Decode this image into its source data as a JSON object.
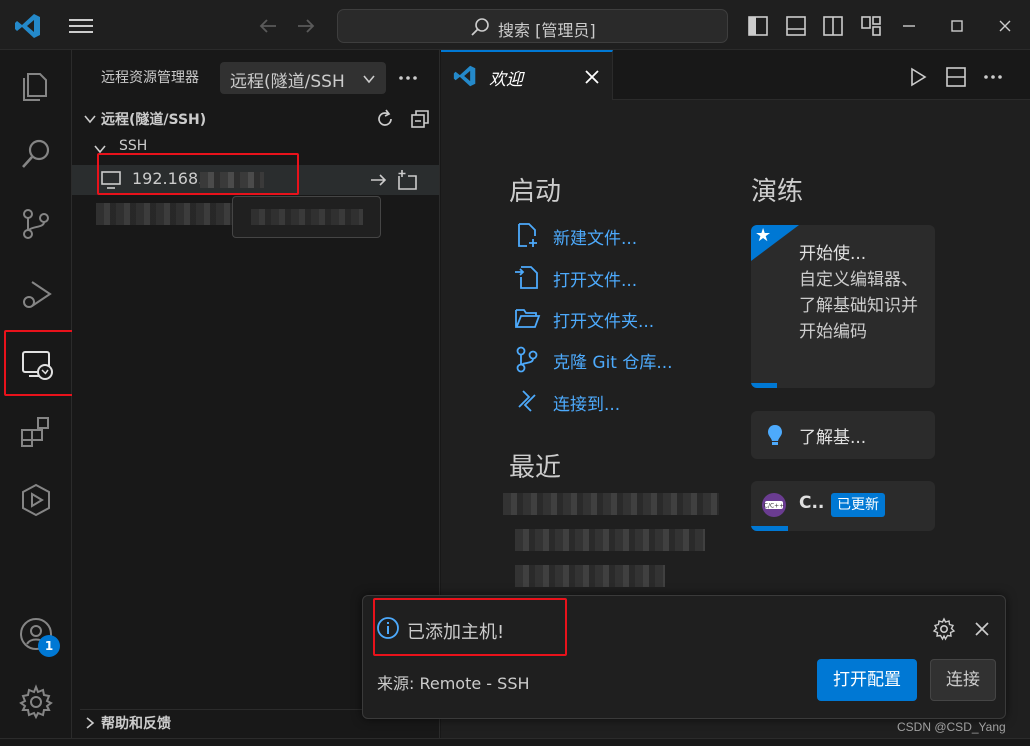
{
  "search": {
    "text": "搜索 [管理员]"
  },
  "sidebar": {
    "title": "远程资源管理器",
    "dropdown": "远程(隧道/SSH",
    "section": "远程(隧道/SSH)",
    "ssh_label": "SSH",
    "host": "192.168.",
    "help": "帮助和反馈"
  },
  "activity": {
    "accounts_badge": "1"
  },
  "editor": {
    "tab_label": "欢迎",
    "start_heading": "启动",
    "start_items": [
      "新建文件...",
      "打开文件...",
      "打开文件夹...",
      "克隆 Git 仓库...",
      "连接到..."
    ],
    "recent_heading": "最近",
    "walkthrough_heading": "演练",
    "walkthroughs": [
      {
        "title": "开始使...",
        "desc": "自定义编辑器、了解基础知识并开始编码",
        "progress": 0.14
      },
      {
        "title": "了解基..."
      },
      {
        "title": "C..",
        "badge": "已更新",
        "progress": 0.2
      }
    ]
  },
  "notification": {
    "message": "已添加主机!",
    "source": "来源: Remote - SSH",
    "primary_button": "打开配置",
    "secondary_button": "连接"
  },
  "watermark": "CSDN @CSD_Yang",
  "colors": {
    "accent": "#0078d4",
    "link": "#4daafc",
    "highlight": "#e8121b"
  }
}
